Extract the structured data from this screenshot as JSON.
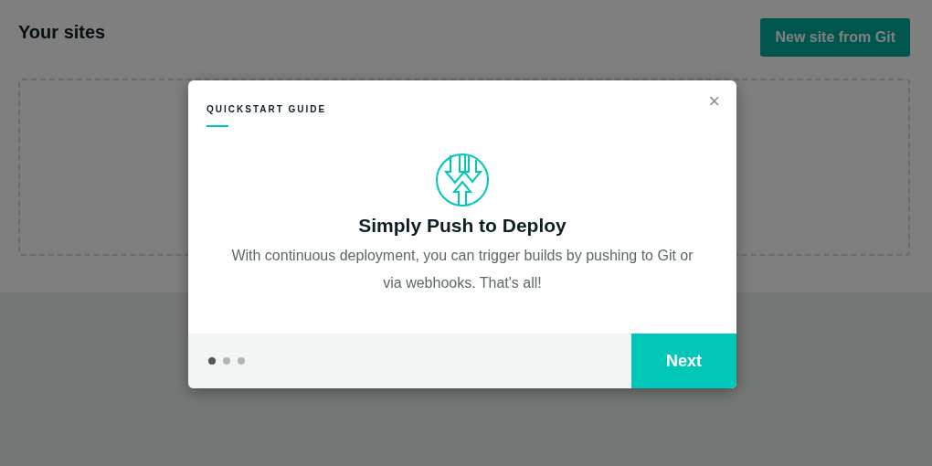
{
  "page": {
    "title": "Your sites",
    "button": "New site from Git"
  },
  "modal": {
    "eyebrow": "QUICKSTART GUIDE",
    "close": "×",
    "heading": "Simply Push to Deploy",
    "body": "With continuous deployment, you can trigger builds by pushing to Git or via webhooks. That's all!",
    "steps": [
      {
        "selected": true
      },
      {
        "selected": false
      },
      {
        "selected": false
      }
    ],
    "next": "Next"
  }
}
